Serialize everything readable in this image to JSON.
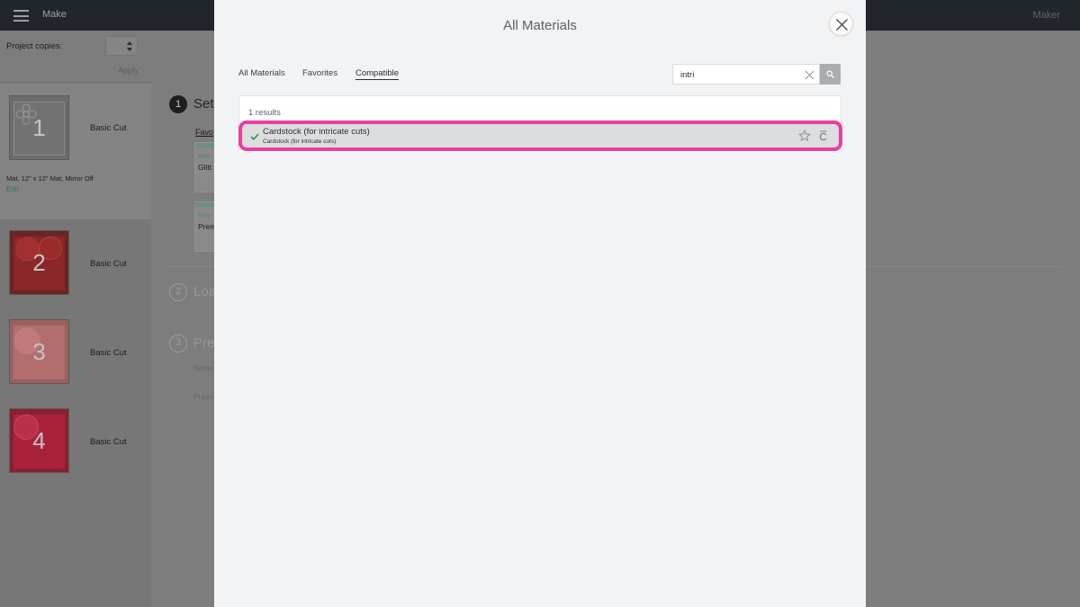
{
  "header": {
    "app_title": "Make",
    "machine": "Maker"
  },
  "sidebar": {
    "copies_label": "Project copies:",
    "apply_label": "Apply",
    "mats": [
      {
        "number": "1",
        "label": "Basic Cut",
        "meta": "Mat, 12\" x 12\" Mat, Mirror Off",
        "edit": "Edit"
      },
      {
        "number": "2",
        "label": "Basic Cut"
      },
      {
        "number": "3",
        "label": "Basic Cut"
      },
      {
        "number": "4",
        "label": "Basic Cut"
      }
    ]
  },
  "background_steps": {
    "step1_num": "1",
    "step1_text": "Set",
    "favorites_link": "Favo",
    "card1_kind": "Iron",
    "card1_value": "Glitt",
    "card2_kind": "Viny",
    "card2_value": "Prem",
    "step2_num": "2",
    "step2_text": "Loa",
    "step3_num": "3",
    "step3_text": "Pre",
    "speed_label": "Speed",
    "pressure_label": "Press"
  },
  "modal": {
    "title": "All Materials",
    "tabs": [
      {
        "label": "All Materials",
        "active": false
      },
      {
        "label": "Favorites",
        "active": false
      },
      {
        "label": "Compatible",
        "active": true
      }
    ],
    "search": {
      "value": "intri",
      "placeholder": "Search"
    },
    "results_count": "1 results",
    "results": [
      {
        "name": "Cardstock (for intricate cuts)",
        "subtitle": "Cardstock (for intricate cuts)",
        "selected": true
      }
    ]
  },
  "colors": {
    "highlight_border": "#ea3f9f",
    "check": "#2e9a57",
    "mat2": "#9b2b2b",
    "mat3": "#b86f6f",
    "mat4": "#a8233a"
  }
}
